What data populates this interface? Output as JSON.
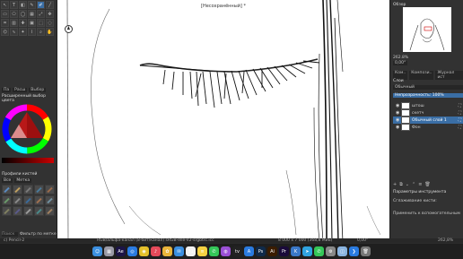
{
  "canvas": {
    "title": "[Несохранённый] *"
  },
  "toolbox": {
    "tools": [
      "cursor-tool",
      "text-tool",
      "fill-tool",
      "edit-tool",
      "brush-tool",
      "line-tool",
      "rect-tool",
      "poly-tool",
      "ellipse-tool",
      "grid-tool",
      "transform-tool",
      "move-tool",
      "crop-tool",
      "gradient-tool",
      "picker-tool",
      "fill-bucket-tool",
      "select-rect-tool",
      "select-ellipse-tool",
      "select-poly-tool",
      "select-free-tool",
      "magic-wand-tool",
      "bezier-tool",
      "zoom-tool",
      "pan-tool"
    ]
  },
  "color_panel": {
    "tabs": [
      "Па",
      "Расш",
      "Выбор"
    ],
    "title": "Расширенный выбор цвета"
  },
  "brush_presets": {
    "title": "Профили кистей",
    "filter_label": "Все",
    "tag_label": "Метка",
    "search_placeholder": "Поиск",
    "filter_by_tag": "Фильтр по метке"
  },
  "right_panel": {
    "overview_title": "Обзор",
    "zoom": "262.8%",
    "rotation": "0,00°",
    "tabs": [
      "Ком..",
      "Компози..",
      "Журнал ист"
    ],
    "layers_title": "Слои",
    "blend_mode": "Обычный",
    "opacity_label": "Непрозрачность: 100%",
    "layers": [
      {
        "name": "штош",
        "active": false
      },
      {
        "name": "скетч",
        "active": false
      },
      {
        "name": "Обычный слой 1",
        "active": true
      },
      {
        "name": "Фон",
        "active": false
      }
    ],
    "tool_options_title": "Параметры инструмента",
    "smoothing_label": "Сглаживание кисти:",
    "apply_label": "Применить к вспомогательным"
  },
  "statusbar": {
    "brush": "c) Pencil-2",
    "color_info": "RGB/альфа-канал (8-бит/канал)  sRGB-elle-V2-srgbtrc.icc",
    "size_info": "8 000 x 7 000 (368,8 МиБ)",
    "angle": "0,00°",
    "zoom": "262,8%"
  },
  "dock": {
    "apps": [
      {
        "name": "finder",
        "color": "#3b8fe0",
        "glyph": "☺"
      },
      {
        "name": "launchpad",
        "color": "#9a9aa6",
        "glyph": "▦"
      },
      {
        "name": "ae",
        "color": "#1c1446",
        "glyph": "Ae"
      },
      {
        "name": "safari",
        "color": "#2a7be0",
        "glyph": "◎"
      },
      {
        "name": "chrome",
        "color": "#e5c02a",
        "glyph": "◉"
      },
      {
        "name": "music",
        "color": "#e64a5a",
        "glyph": "♪"
      },
      {
        "name": "photos",
        "color": "#eab53a",
        "glyph": "✿"
      },
      {
        "name": "mail",
        "color": "#3b8fe0",
        "glyph": "✉"
      },
      {
        "name": "calendar",
        "color": "#f2f2f2",
        "glyph": "31"
      },
      {
        "name": "notes",
        "color": "#f5d142",
        "glyph": "≡"
      },
      {
        "name": "messages",
        "color": "#35c759",
        "glyph": "✆"
      },
      {
        "name": "podcasts",
        "color": "#9b50d6",
        "glyph": "◍"
      },
      {
        "name": "tv",
        "color": "#222",
        "glyph": "tv"
      },
      {
        "name": "appstore",
        "color": "#2a7be0",
        "glyph": "A"
      },
      {
        "name": "photoshop",
        "color": "#0f2a4a",
        "glyph": "Ps"
      },
      {
        "name": "illustrator",
        "color": "#3a1c00",
        "glyph": "Ai"
      },
      {
        "name": "premiere",
        "color": "#1a0a3a",
        "glyph": "Pr"
      },
      {
        "name": "krita",
        "color": "#3a78c8",
        "glyph": "K"
      },
      {
        "name": "telegram",
        "color": "#2fa3e0",
        "glyph": "➤"
      },
      {
        "name": "whatsapp",
        "color": "#35c759",
        "glyph": "✆"
      },
      {
        "name": "settings",
        "color": "#888",
        "glyph": "⚙"
      },
      {
        "name": "preview",
        "color": "#8ab4e0",
        "glyph": "◫"
      },
      {
        "name": "vscode",
        "color": "#2a7be0",
        "glyph": "❯"
      },
      {
        "name": "trash",
        "color": "#777",
        "glyph": "🗑"
      }
    ]
  }
}
